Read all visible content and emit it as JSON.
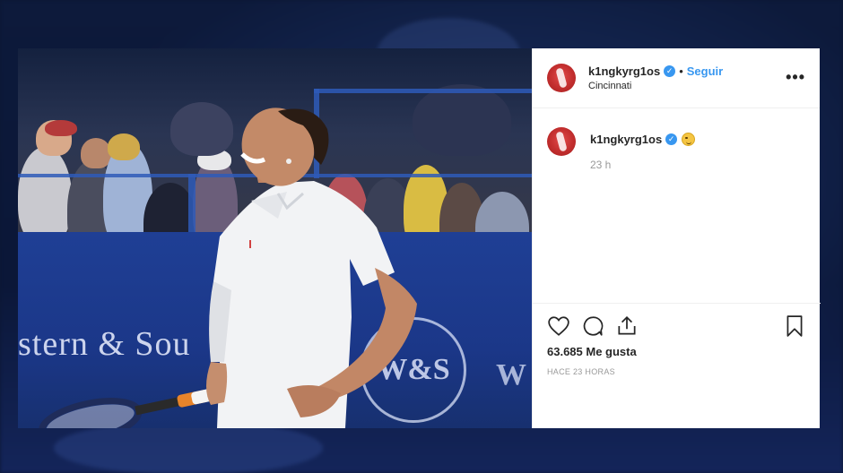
{
  "post": {
    "header": {
      "username": "k1ngkyrg1os",
      "verified": true,
      "separator": "•",
      "follow_label": "Seguir",
      "location": "Cincinnati",
      "more_icon": "more-horizontal-icon"
    },
    "caption": {
      "username": "k1ngkyrg1os",
      "verified": true,
      "emoji": "smirk-emoji",
      "time_ago": "23 h"
    },
    "photo": {
      "wall_text": "stern & Sou",
      "logo_text": "W&S",
      "logo_text_2": "W"
    },
    "actions": {
      "like_icon": "heart-icon",
      "comment_icon": "comment-icon",
      "share_icon": "share-icon",
      "save_icon": "bookmark-icon",
      "likes_text": "63.685 Me gusta",
      "timestamp": "HACE 23 HORAS"
    }
  },
  "colors": {
    "accent": "#3897f0",
    "text": "#262626",
    "muted": "#999999",
    "border": "#efefef"
  }
}
